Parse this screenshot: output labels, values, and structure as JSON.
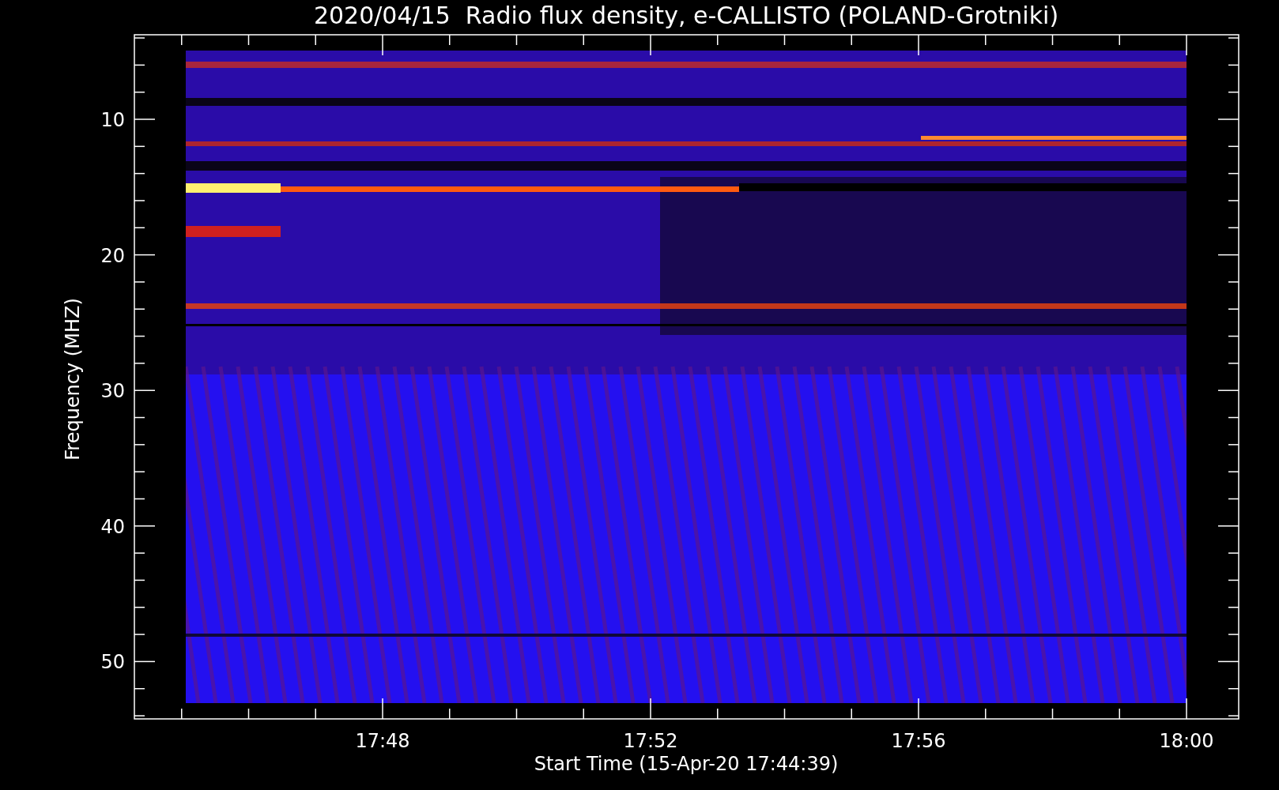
{
  "title": "2020/04/15  Radio flux density, e-CALLISTO (POLAND-Grotniki)",
  "y_axis": {
    "label": "Frequency (MHZ)",
    "ticks": [
      "10",
      "20",
      "30",
      "40",
      "50"
    ]
  },
  "x_axis": {
    "label": "Start Time (15-Apr-20 17:44:39)",
    "ticks": [
      "17:48",
      "17:52",
      "17:56",
      "18:00"
    ]
  }
}
